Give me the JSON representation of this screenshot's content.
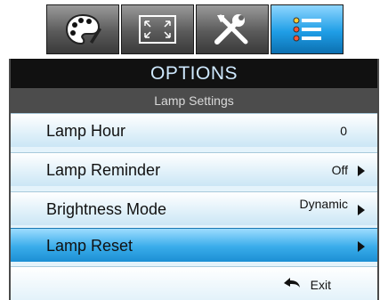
{
  "tabs": [
    {
      "icon": "palette-icon"
    },
    {
      "icon": "fullscreen-icon"
    },
    {
      "icon": "tools-icon"
    },
    {
      "icon": "list-icon",
      "active": true
    }
  ],
  "header": {
    "title": "OPTIONS",
    "subtitle": "Lamp Settings"
  },
  "rows": [
    {
      "label": "Lamp Hour",
      "value": "0"
    },
    {
      "label": "Lamp Reminder",
      "value": "Off"
    },
    {
      "label": "Brightness Mode",
      "value": "Dynamic"
    },
    {
      "label": "Lamp Reset",
      "value": ""
    }
  ],
  "footer": {
    "exit_label": "Exit"
  },
  "colors": {
    "accent": "#1f9ee6",
    "header": "#111111",
    "subheader": "#4c4c4c"
  }
}
